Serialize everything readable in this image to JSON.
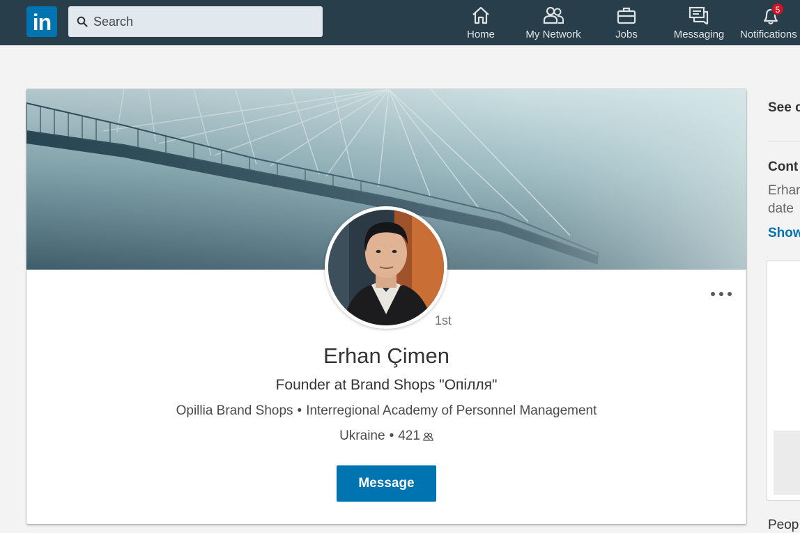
{
  "nav": {
    "logo_text": "in",
    "search_placeholder": "Search",
    "items": [
      {
        "label": "Home",
        "icon": "home-icon"
      },
      {
        "label": "My Network",
        "icon": "network-icon"
      },
      {
        "label": "Jobs",
        "icon": "briefcase-icon"
      },
      {
        "label": "Messaging",
        "icon": "messaging-icon"
      },
      {
        "label": "Notifications",
        "icon": "bell-icon",
        "badge": "5"
      }
    ],
    "colors": {
      "bar": "#283e4a",
      "brand": "#0073b1",
      "badge": "#d11124"
    }
  },
  "profile": {
    "name": "Erhan Çimen",
    "degree": "1st",
    "headline": "Founder at Brand Shops \"Опілля\"",
    "company": "Opillia Brand Shops",
    "education": "Interregional Academy of Personnel Management",
    "separator": "•",
    "location": "Ukraine",
    "connections": "421",
    "message_button": "Message"
  },
  "rail": {
    "see_label": "See c",
    "contact_title": "Cont",
    "contact_line1": "Erhar",
    "contact_line2": "date",
    "show_link": "Show",
    "people_label": "Peop"
  }
}
